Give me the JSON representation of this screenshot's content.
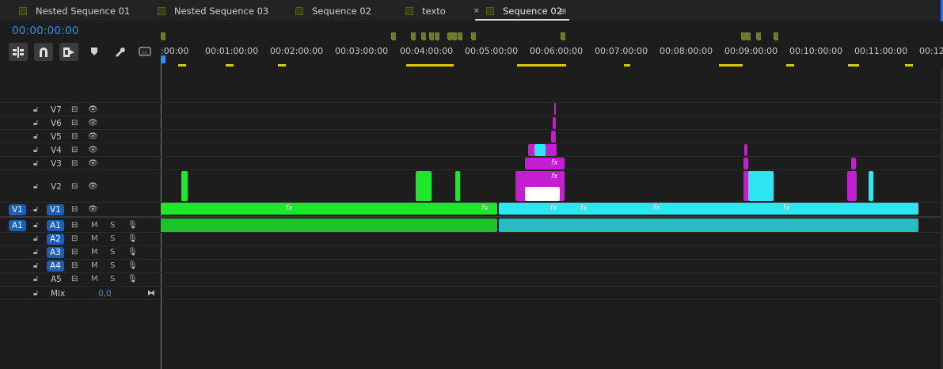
{
  "tabs": [
    {
      "label": "Nested Sequence 01"
    },
    {
      "label": "Nested Sequence 03"
    },
    {
      "label": "Sequence 02"
    },
    {
      "label": "texto"
    },
    {
      "label": "Sequence 02"
    }
  ],
  "tab_close_glyph": "×",
  "tab_menu_glyph": "≡",
  "timecode": "00:00:00:00",
  "toolbar": {
    "tools": [
      "insert-overwrite-icon",
      "snap-icon",
      "linked-selection-icon",
      "add-marker-icon",
      "settings-wrench-icon",
      "captions-icon"
    ]
  },
  "ruler": {
    "labels": [
      ":00:00",
      "00:01:00:00",
      "00:02:00:00",
      "00:03:00:00",
      "00:04:00:00",
      "00:05:00:00",
      "00:06:00:00",
      "00:07:00:00",
      "00:08:00:00",
      "00:09:00:00",
      "00:10:00:00",
      "00:11:00:00",
      "00:12:"
    ]
  },
  "tracks": {
    "video": [
      {
        "name": "V7"
      },
      {
        "name": "V6"
      },
      {
        "name": "V5"
      },
      {
        "name": "V4"
      },
      {
        "name": "V3"
      },
      {
        "name": "V2"
      },
      {
        "name": "V1",
        "source_patch": "V1",
        "target": "V1"
      }
    ],
    "audio": [
      {
        "name": "A1",
        "source_patch": "A1",
        "target": "A1"
      },
      {
        "name": "A2",
        "target": "A2"
      },
      {
        "name": "A3",
        "target": "A3"
      },
      {
        "name": "A4",
        "target": "A4"
      },
      {
        "name": "A5"
      }
    ],
    "mute_label": "M",
    "solo_label": "S",
    "mix": {
      "name": "Mix",
      "value": "0,0"
    }
  },
  "fx_label": "fx",
  "colors": {
    "accent": "#2f8cf1",
    "clip_green": "#1ee62a",
    "clip_cyan": "#2ee6f0",
    "clip_magenta": "#c21fd1",
    "marker": "#6e7a1e",
    "render_bar": "#d9c90c"
  }
}
